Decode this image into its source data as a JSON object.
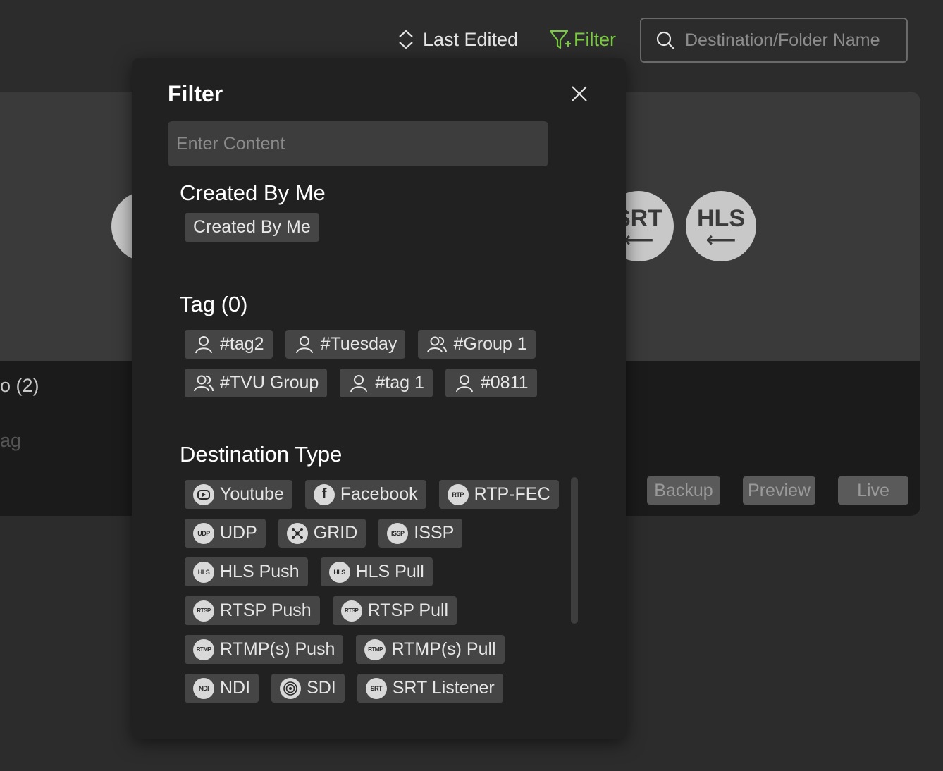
{
  "toolbar": {
    "sort_label": "Last Edited",
    "filter_label": "Filter",
    "search_placeholder": "Destination/Folder Name"
  },
  "background_card": {
    "title": "o (2)",
    "tag_text": "ag",
    "protocol_circles": [
      "SRT",
      "HLS"
    ],
    "buttons": {
      "backup": "Backup",
      "preview": "Preview",
      "live": "Live"
    }
  },
  "filter_panel": {
    "title": "Filter",
    "search_placeholder": "Enter Content",
    "created_section": {
      "title": "Created By Me",
      "chips": [
        "Created By Me"
      ]
    },
    "tag_section": {
      "title": "Tag (0)",
      "chips": [
        {
          "label": "#tag2",
          "icon": "user-icon"
        },
        {
          "label": "#Tuesday",
          "icon": "user-icon"
        },
        {
          "label": "#Group 1",
          "icon": "users-icon"
        },
        {
          "label": "#TVU Group",
          "icon": "users-icon"
        },
        {
          "label": "#tag 1",
          "icon": "user-icon"
        },
        {
          "label": "#0811",
          "icon": "user-icon"
        }
      ]
    },
    "type_section": {
      "title": "Destination Type",
      "chips": [
        {
          "label": "Youtube",
          "icon": "youtube-icon"
        },
        {
          "label": "Facebook",
          "icon": "facebook-icon"
        },
        {
          "label": "RTP-FEC",
          "icon": "rtp-icon"
        },
        {
          "label": "UDP",
          "icon": "udp-icon"
        },
        {
          "label": "GRID",
          "icon": "grid-icon"
        },
        {
          "label": "ISSP",
          "icon": "issp-icon"
        },
        {
          "label": "HLS Push",
          "icon": "hls-push-icon"
        },
        {
          "label": "HLS Pull",
          "icon": "hls-pull-icon"
        },
        {
          "label": "RTSP Push",
          "icon": "rtsp-push-icon"
        },
        {
          "label": "RTSP Pull",
          "icon": "rtsp-pull-icon"
        },
        {
          "label": "RTMP(s) Push",
          "icon": "rtmp-push-icon"
        },
        {
          "label": "RTMP(s) Pull",
          "icon": "rtmp-pull-icon"
        },
        {
          "label": "NDI",
          "icon": "ndi-icon"
        },
        {
          "label": "SDI",
          "icon": "sdi-icon"
        },
        {
          "label": "SRT Listener",
          "icon": "srt-listener-icon"
        }
      ]
    }
  },
  "colors": {
    "accent": "#7ac943",
    "panel_bg": "#212121",
    "chip_bg": "#454545",
    "page_bg": "#2c2c2c"
  }
}
